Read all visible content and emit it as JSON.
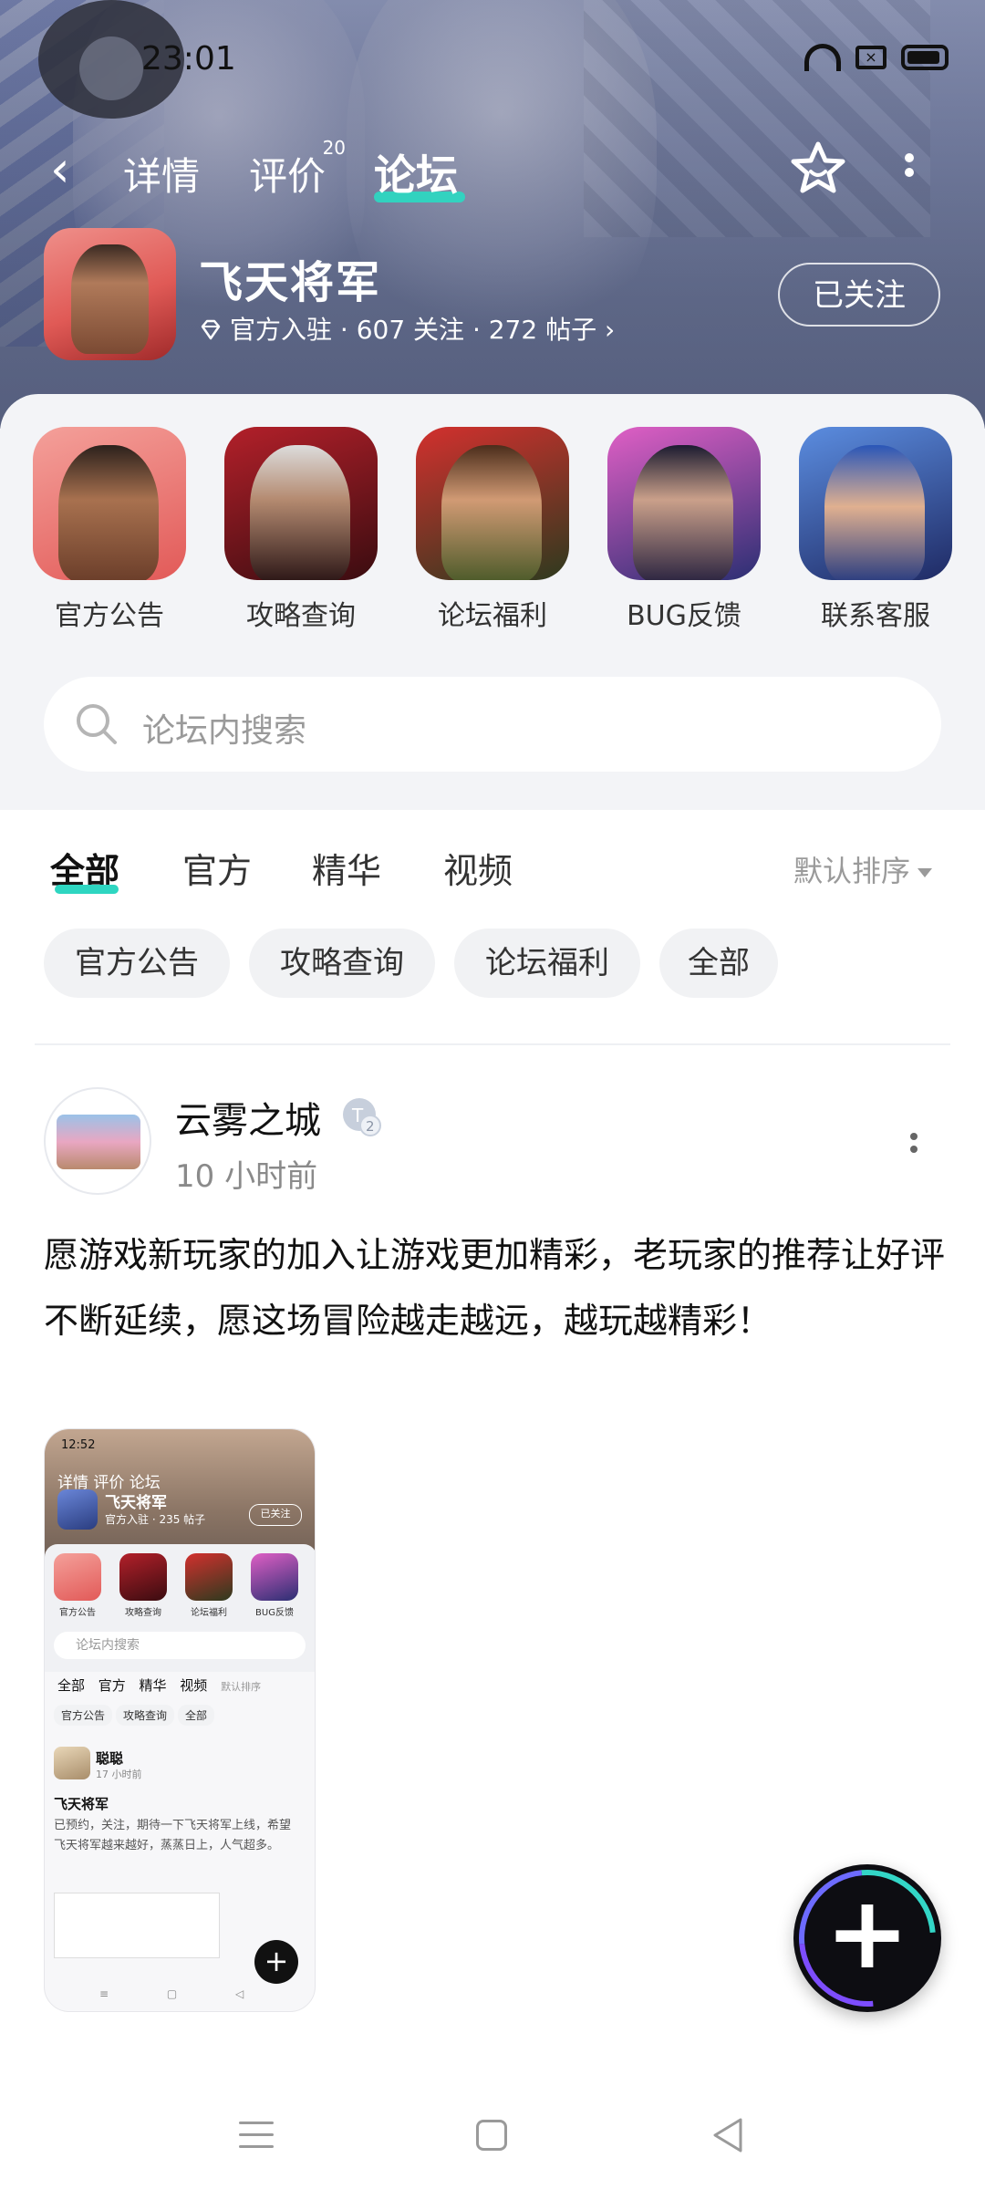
{
  "status_bar": {
    "time": "23:01"
  },
  "nav": {
    "back_icon": "back-arrow-icon",
    "tabs": [
      {
        "label": "详情"
      },
      {
        "label": "评价",
        "count": "20"
      },
      {
        "label": "论坛"
      }
    ],
    "active_tab": "论坛",
    "accent_color": "#2ed6c1"
  },
  "game": {
    "title": "飞天将军",
    "meta": "官方入驻 · 607 关注 · 272 帖子",
    "follow_label": "已关注"
  },
  "shortcuts": [
    {
      "label": "官方公告"
    },
    {
      "label": "攻略查询"
    },
    {
      "label": "论坛福利"
    },
    {
      "label": "BUG反馈"
    },
    {
      "label": "联系客服"
    }
  ],
  "search": {
    "placeholder": "论坛内搜索"
  },
  "filter_tabs": [
    {
      "label": "全部"
    },
    {
      "label": "官方"
    },
    {
      "label": "精华"
    },
    {
      "label": "视频"
    }
  ],
  "sort_label": "默认排序",
  "chips": [
    {
      "label": "官方公告"
    },
    {
      "label": "攻略查询"
    },
    {
      "label": "论坛福利"
    },
    {
      "label": "全部"
    }
  ],
  "post": {
    "author": "云雾之城",
    "time": "10 小时前",
    "body": "愿游戏新玩家的加入让游戏更加精彩，老玩家的推荐让好评不断延续，愿这场冒险越走越远，越玩越精彩！",
    "image": {
      "time": "12:52",
      "nav": "详情  评价  论坛",
      "title": "飞天将军",
      "meta": "官方入驻 · 235 帖子",
      "follow": "已关注",
      "shortcuts": [
        "官方公告",
        "攻略查询",
        "论坛福利",
        "BUG反馈"
      ],
      "search": "论坛内搜索",
      "tabs": "全部 官方 精华 视频",
      "sort": "默认排序",
      "chips": [
        "官方公告",
        "攻略查询",
        "全部"
      ],
      "author": "聪聪",
      "post_time": "17 小时前",
      "post_title": "飞天将军",
      "post_body": "已预约，关注，期待一下飞天将军上线，希望飞天将军越来越好，蒸蒸日上，人气超多。"
    }
  },
  "fab_icon": "plus-icon"
}
